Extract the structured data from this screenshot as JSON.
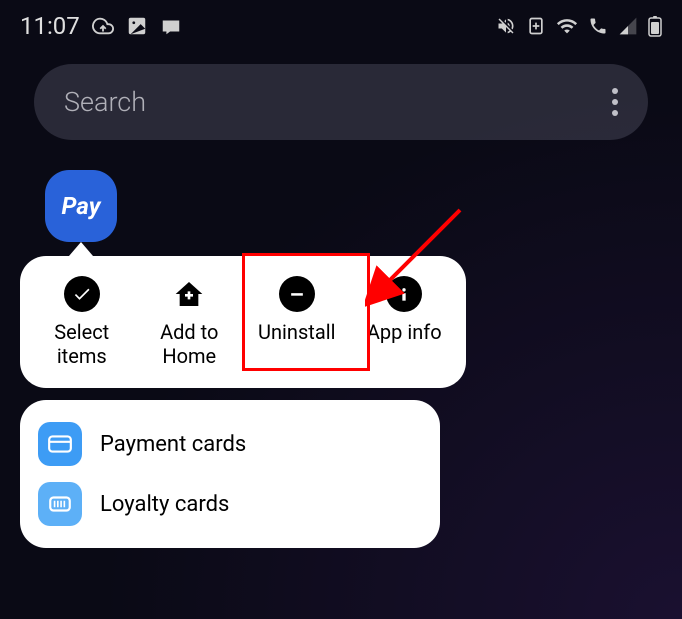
{
  "status": {
    "time": "11:07"
  },
  "search": {
    "placeholder": "Search"
  },
  "app": {
    "icon_label": "Pay"
  },
  "menu": {
    "items": [
      {
        "label": "Select\nitems"
      },
      {
        "label": "Add to\nHome"
      },
      {
        "label": "Uninstall"
      },
      {
        "label": "App info"
      }
    ]
  },
  "shortcuts": {
    "items": [
      {
        "label": "Payment cards"
      },
      {
        "label": "Loyalty cards"
      }
    ]
  }
}
